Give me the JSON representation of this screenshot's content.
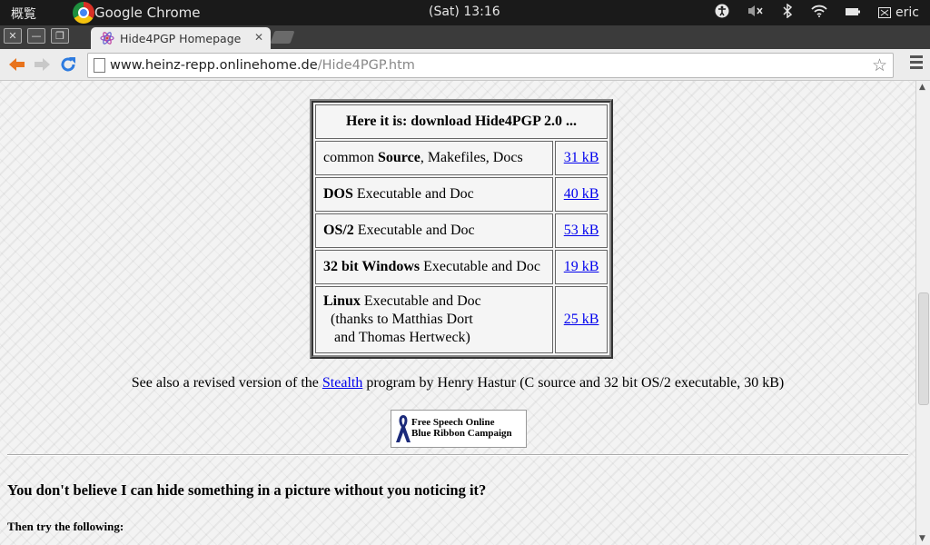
{
  "system": {
    "activities": "概覧",
    "app_name": "Google Chrome",
    "clock": "(Sat) 13:16",
    "user": "eric"
  },
  "window_controls": {
    "close": "✕",
    "minimize": "—",
    "restore": "❐"
  },
  "tab": {
    "title": "Hide4PGP Homepage",
    "close": "✕"
  },
  "omnibox": {
    "host": "www.heinz-repp.onlinehome.de",
    "path": "/Hide4PGP.htm"
  },
  "page": {
    "download_header": "Here it is: download Hide4PGP 2.0 ...",
    "rows": [
      {
        "bold": "",
        "pre": "common ",
        "mid_bold": "Source",
        "post": ", Makefiles, Docs",
        "size": "31 kB"
      },
      {
        "bold": "DOS",
        "text": " Executable and Doc",
        "size": "40 kB"
      },
      {
        "bold": "OS/2",
        "text": " Executable and Doc",
        "size": "53 kB"
      },
      {
        "bold": "32 bit Windows",
        "text": " Executable and Doc",
        "size": "19 kB"
      },
      {
        "bold": "Linux",
        "text": " Executable and Doc",
        "line2": "(thanks to Matthias Dort",
        "line3": "and Thomas Hertweck)",
        "size": "25 kB"
      }
    ],
    "see_also_pre": "See also a revised version of the ",
    "see_also_link": "Stealth",
    "see_also_post": " program by Henry Hastur (C source and 32 bit OS/2 executable, 30 kB)",
    "ribbon_line1": "Free Speech Online",
    "ribbon_line2": "Blue Ribbon Campaign",
    "question": "You don't believe I can hide something in a picture without you noticing it?",
    "try": "Then try the following:"
  }
}
